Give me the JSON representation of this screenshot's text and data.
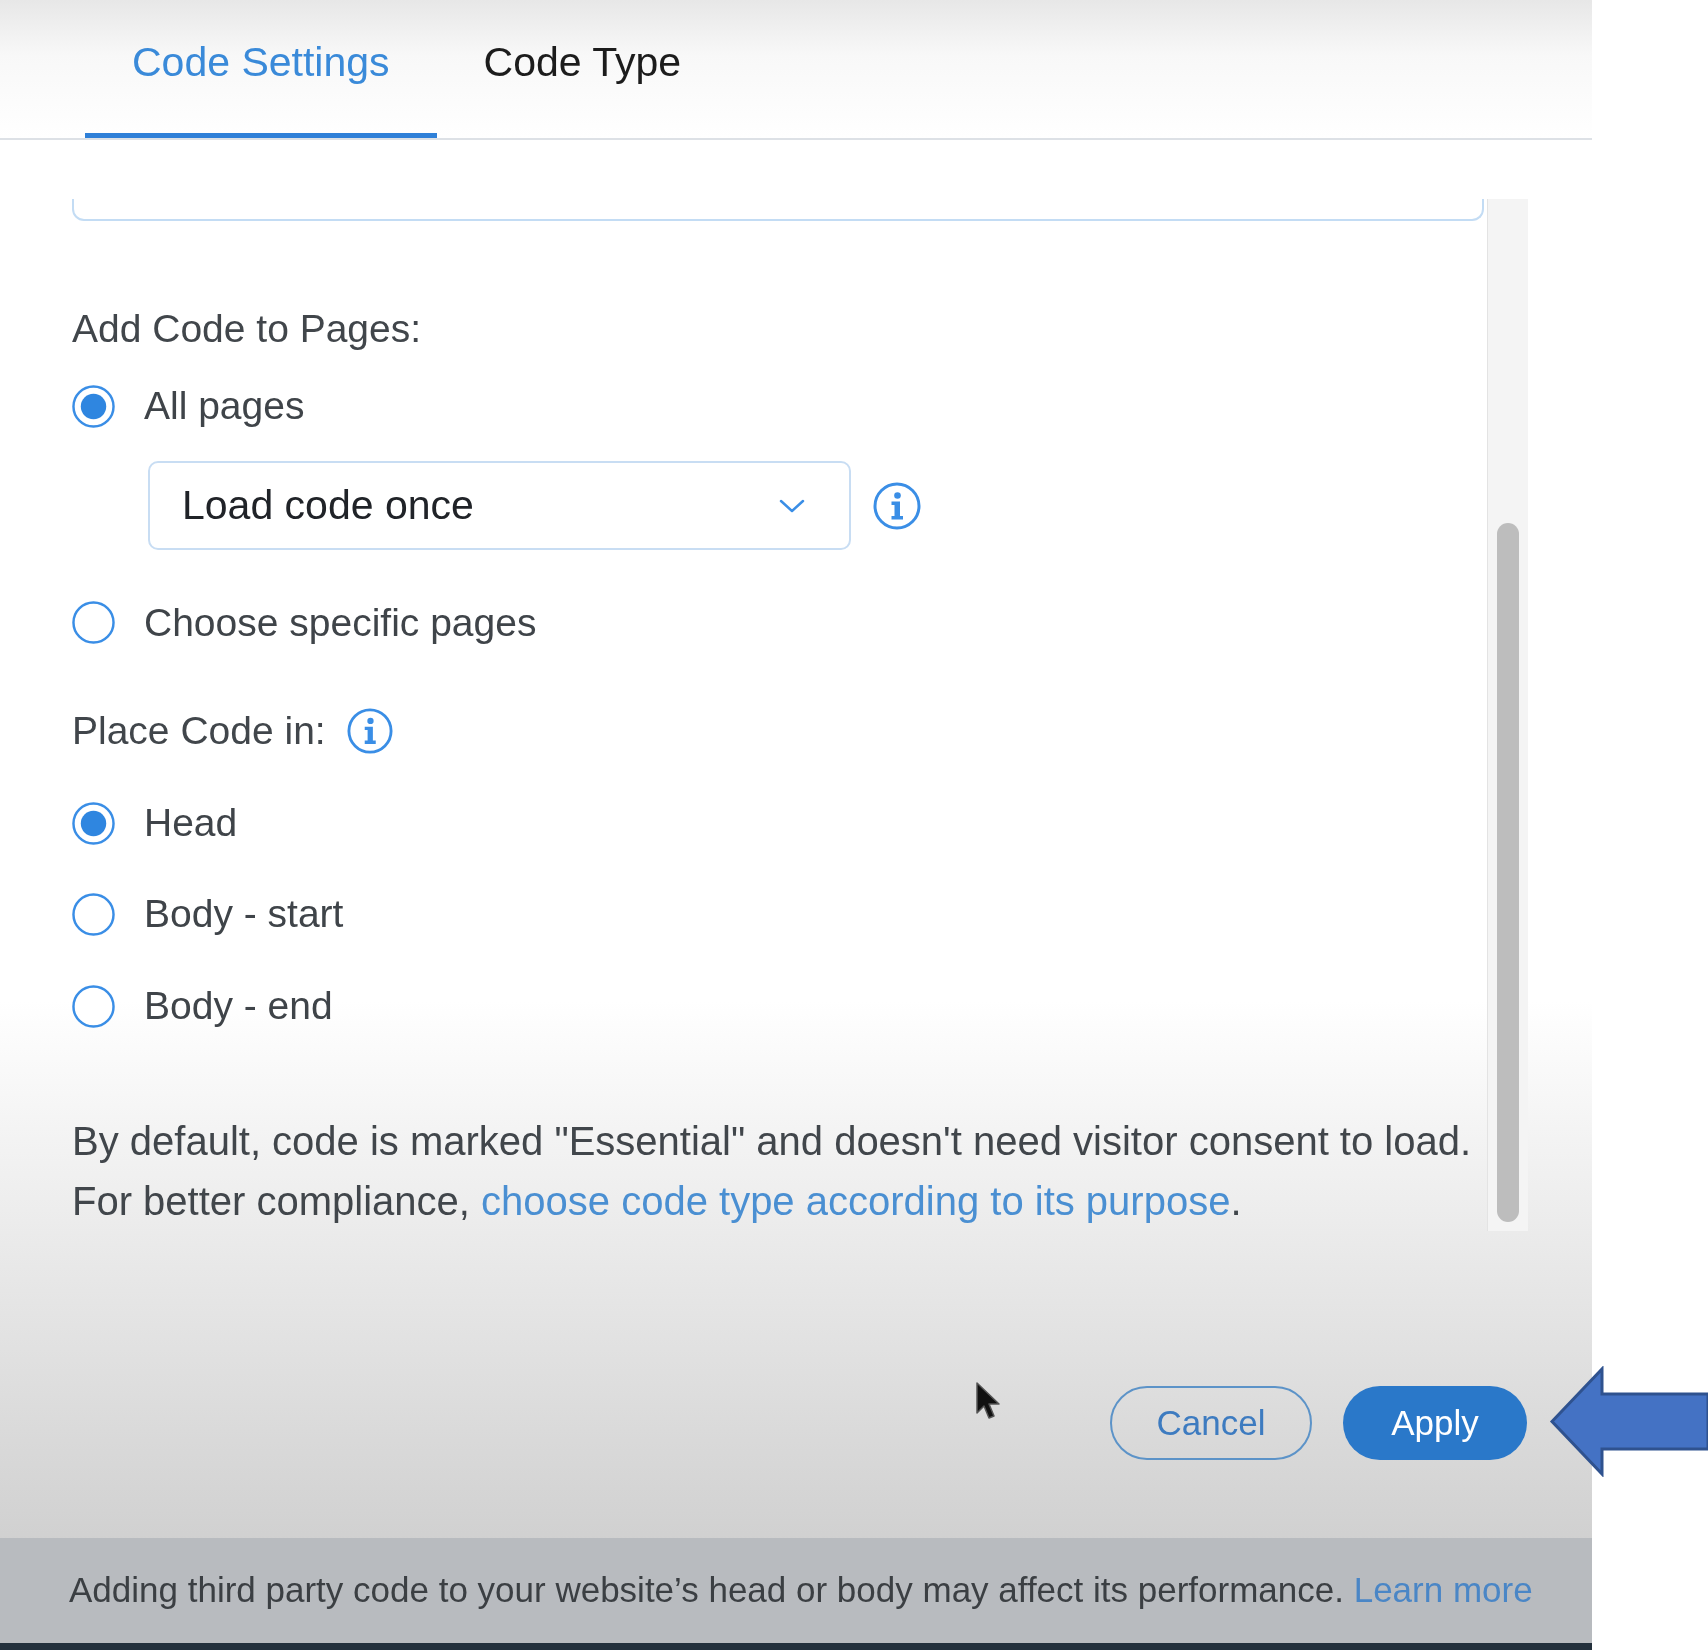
{
  "tabs": [
    {
      "label": "Code Settings",
      "selected": true
    },
    {
      "label": "Code Type",
      "selected": false
    }
  ],
  "pages_section": {
    "label": "Add Code to Pages:",
    "options": [
      {
        "label": "All pages",
        "selected": true,
        "dropdown": {
          "value": "Load code once"
        }
      },
      {
        "label": "Choose specific pages",
        "selected": false
      }
    ]
  },
  "placement_section": {
    "label": "Place Code in:",
    "options": [
      {
        "label": "Head",
        "selected": true
      },
      {
        "label": "Body - start",
        "selected": false
      },
      {
        "label": "Body - end",
        "selected": false
      }
    ]
  },
  "notice": {
    "text": "By default, code is marked \"Essential\" and doesn't need visitor consent to load. For better compliance,",
    "link": "choose code type according to its purpose",
    "after_link": "."
  },
  "buttons": [
    {
      "label": "Cancel",
      "kind": "secondary"
    },
    {
      "label": "Apply",
      "kind": "primary"
    }
  ],
  "footer": {
    "text": "Adding third party code to your website’s head or body may affect its performance.",
    "link": "Learn more"
  }
}
